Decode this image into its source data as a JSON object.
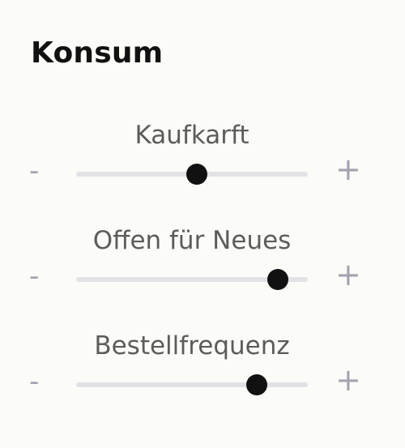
{
  "section": {
    "title": "Konsum"
  },
  "sliders": [
    {
      "label": "Kaufkarft",
      "value": 0.52,
      "minus": "-",
      "plus": "+"
    },
    {
      "label": "Offen für Neues",
      "value": 0.87,
      "minus": "-",
      "plus": "+"
    },
    {
      "label": "Bestellfrequenz",
      "value": 0.78,
      "minus": "-",
      "plus": "+"
    }
  ],
  "colors": {
    "background": "#fbfbf8",
    "title": "#111111",
    "label": "#5c5c5c",
    "control": "#a3a3b2",
    "track": "#e2e2e6",
    "thumb": "#111111"
  }
}
